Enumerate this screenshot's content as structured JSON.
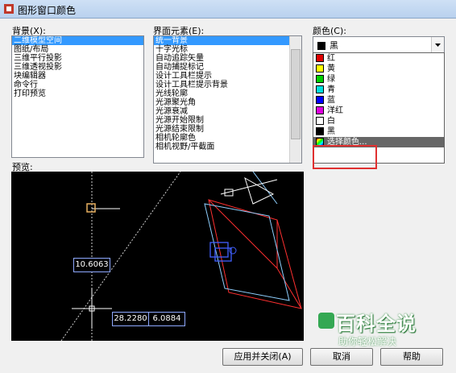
{
  "window": {
    "title": "图形窗口颜色"
  },
  "context": {
    "label": "背景(X):",
    "items": [
      "二维模型空间",
      "图纸/布局",
      "三维平行投影",
      "三维透视投影",
      "块编辑器",
      "命令行",
      "打印预览"
    ],
    "selected_index": 0
  },
  "interface_element": {
    "label": "界面元素(E):",
    "items": [
      "统一背景",
      "十字光标",
      "自动追踪矢量",
      "自动捕捉标记",
      "设计工具栏提示",
      "设计工具栏提示背景",
      "光线轮廓",
      "光源聚光角",
      "光源衰减",
      "光源开始限制",
      "光源结束限制",
      "相机轮廓色",
      "相机视野/平截面"
    ],
    "selected_index": 0
  },
  "color": {
    "label": "颜色(C):",
    "selected_value": "黑",
    "selected_swatch": "#000000",
    "options": [
      {
        "label": "红",
        "swatch": "#e00000"
      },
      {
        "label": "黄",
        "swatch": "#ffff00"
      },
      {
        "label": "绿",
        "swatch": "#00d000"
      },
      {
        "label": "青",
        "swatch": "#00e0e0"
      },
      {
        "label": "蓝",
        "swatch": "#0000ff"
      },
      {
        "label": "洋红",
        "swatch": "#e000e0"
      },
      {
        "label": "白",
        "swatch": "#ffffff"
      },
      {
        "label": "黑",
        "swatch": "#000000"
      },
      {
        "label": "选择颜色...",
        "swatch": "palette-icon",
        "highlighted": true
      }
    ]
  },
  "preview": {
    "label": "预览:",
    "values": [
      "10.6063",
      "28.2280",
      "6.0884"
    ]
  },
  "buttons": {
    "apply_close": "应用并关闭(A)",
    "cancel": "取消",
    "help": "帮助"
  },
  "watermark": {
    "title": "百科全说",
    "subtitle": "助你轻松解决"
  }
}
